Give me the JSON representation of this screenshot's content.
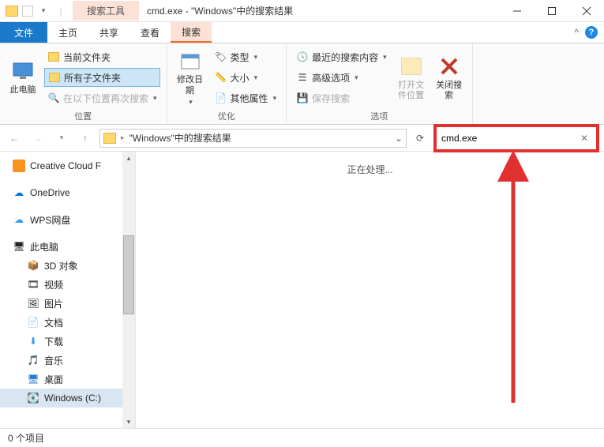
{
  "titlebar": {
    "context_tab": "搜索工具",
    "title": "cmd.exe - \"Windows\"中的搜索结果"
  },
  "menubar": {
    "file": "文件",
    "home": "主页",
    "share": "共享",
    "view": "查看",
    "search": "搜索"
  },
  "ribbon": {
    "location": {
      "this_pc": "此电脑",
      "current_folder": "当前文件夹",
      "all_subfolders": "所有子文件夹",
      "search_again": "在以下位置再次搜索",
      "group_label": "位置"
    },
    "refine": {
      "modify_date": "修改日期",
      "type": "类型",
      "size": "大小",
      "other_props": "其他属性",
      "group_label": "优化"
    },
    "options": {
      "recent": "最近的搜索内容",
      "advanced": "高级选项",
      "save_search": "保存搜索",
      "open_location": "打开文件位置",
      "close_search": "关闭搜索",
      "group_label": "选项"
    }
  },
  "address": {
    "path": "\"Windows\"中的搜索结果"
  },
  "search": {
    "value": "cmd.exe"
  },
  "nav": {
    "creative_cloud": "Creative Cloud F",
    "onedrive": "OneDrive",
    "wps": "WPS网盘",
    "this_pc": "此电脑",
    "objects_3d": "3D 对象",
    "videos": "视频",
    "pictures": "图片",
    "documents": "文档",
    "downloads": "下载",
    "music": "音乐",
    "desktop": "桌面",
    "windows_c": "Windows (C:)"
  },
  "main": {
    "processing": "正在处理..."
  },
  "statusbar": {
    "items": "0 个项目"
  }
}
